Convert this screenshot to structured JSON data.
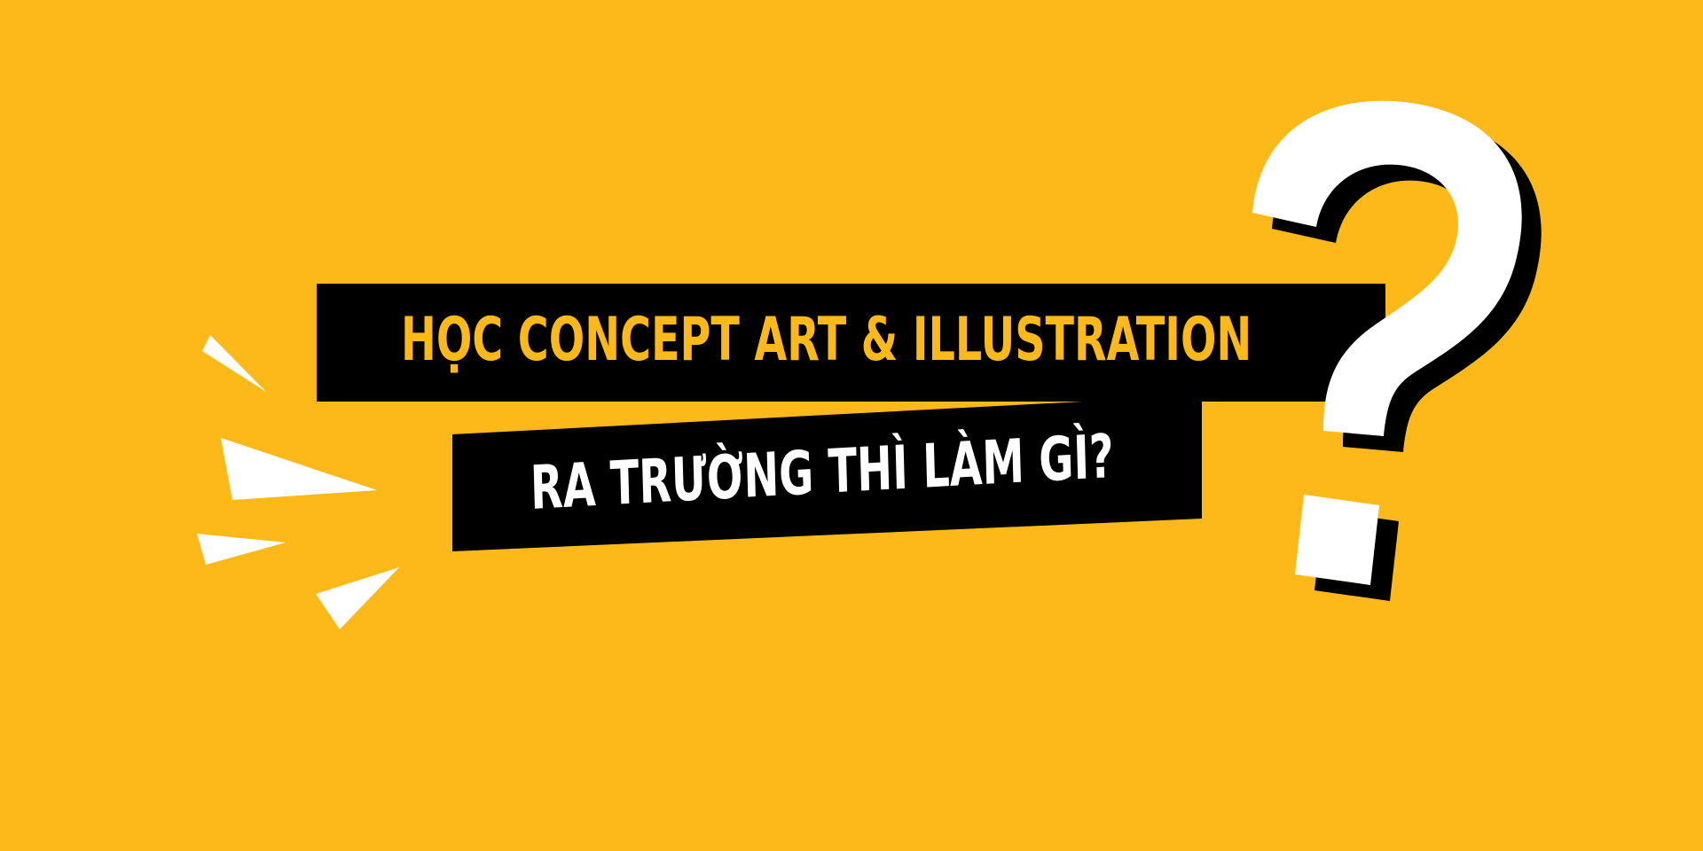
{
  "banner": {
    "background_color": "#fdb919",
    "headline_line_1": "HỌC CONCEPT ART & ILLUSTRATION",
    "headline_line_2": "RA TRƯỜNG THÌ LÀM GÌ?",
    "line_1_color": "#fdb919",
    "line_2_color": "#ffffff",
    "bar_color": "#000000"
  },
  "decor": {
    "question_mark_icon": "question-mark-icon",
    "burst_icon": "burst-lines-icon"
  }
}
